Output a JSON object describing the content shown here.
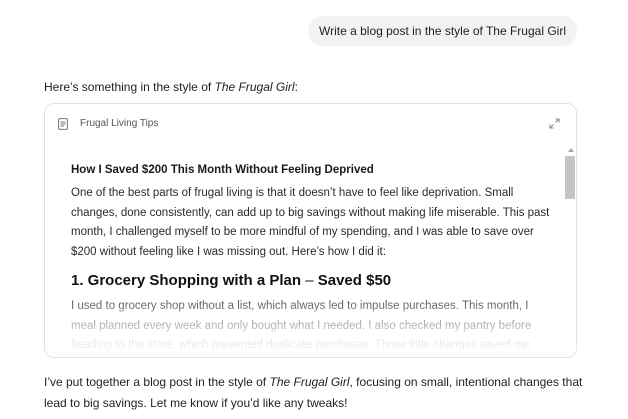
{
  "user_message": "Write a blog post in the style of The Frugal Girl",
  "intro": {
    "before": "Here’s something in the style of ",
    "emphasis": "The Frugal Girl",
    "after": ":"
  },
  "document": {
    "title": "Frugal Living Tips",
    "icon": "document-icon",
    "expand_icon": "expand-icon",
    "post_title": "How I Saved $200 This Month Without Feeling Deprived",
    "paragraph1": "One of the best parts of frugal living is that it doesn’t have to feel like deprivation. Small changes, done consistently, can add up to big savings without making life miserable. This past month, I challenged myself to be more mindful of my spending, and I was able to save over $200 without feeling like I was missing out. Here’s how I did it:",
    "section1_heading": "1. Grocery Shopping with a Plan",
    "section1_dash": " – ",
    "section1_saved": "Saved $50",
    "paragraph2": "I used to grocery shop without a list, which always led to impulse purchases. This month, I meal planned every week and only bought what I needed. I also checked my pantry before heading to the store, which prevented duplicate purchases. Those little changes saved me"
  },
  "outro": {
    "before": "I’ve put together a blog post in the style of ",
    "emphasis": "The Frugal Girl",
    "after": ", focusing on small, intentional changes that lead to big savings. Let me know if you’d like any tweaks!"
  }
}
